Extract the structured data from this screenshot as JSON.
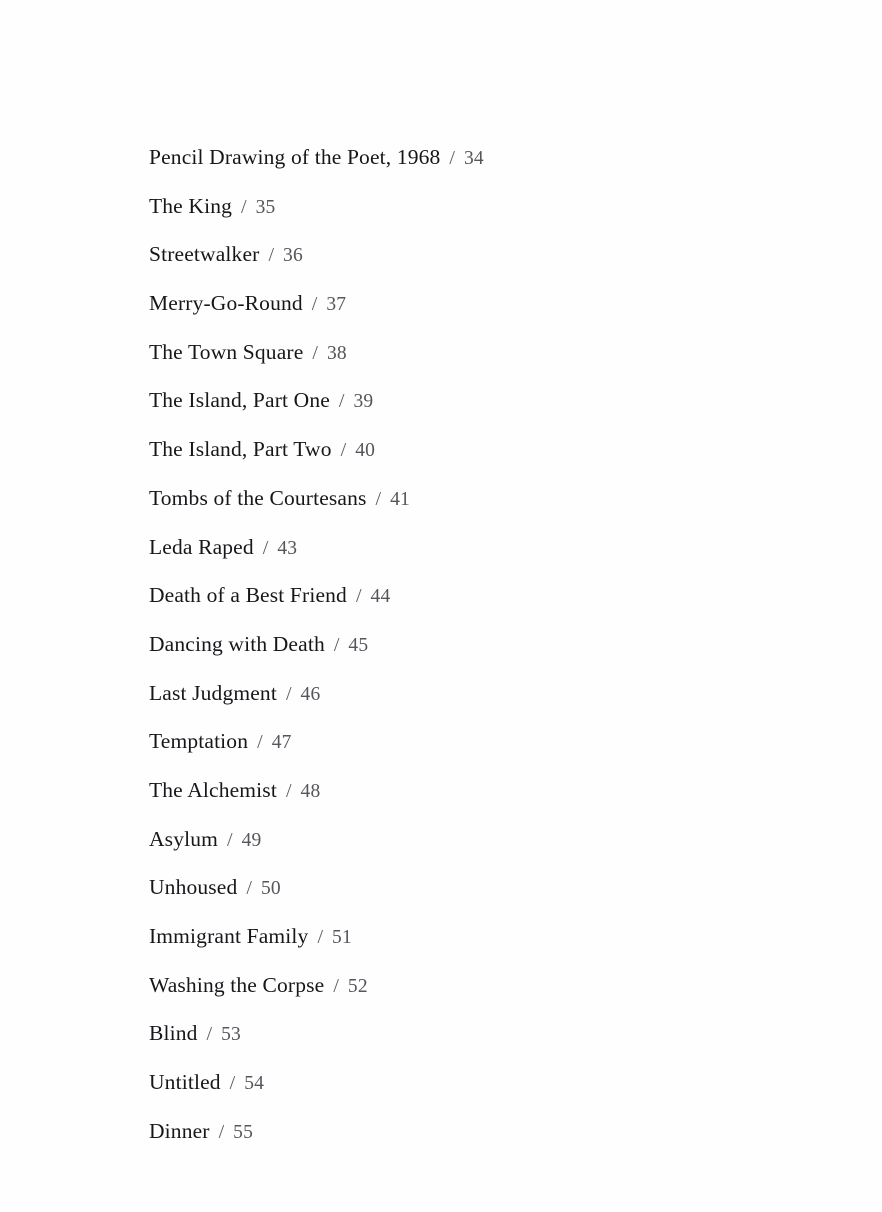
{
  "document": {
    "kind": "table-of-contents",
    "separator": "/",
    "background_color": "#fefefe",
    "title_color": "#17171b",
    "page_number_color": "#55555c"
  },
  "entries": [
    {
      "title": "Pencil Drawing of the Poet, 1968",
      "page": "34"
    },
    {
      "title": "The King",
      "page": "35"
    },
    {
      "title": "Streetwalker",
      "page": "36"
    },
    {
      "title": "Merry-Go-Round",
      "page": "37"
    },
    {
      "title": "The Town Square",
      "page": "38"
    },
    {
      "title": "The Island, Part One",
      "page": "39"
    },
    {
      "title": "The Island, Part Two",
      "page": "40"
    },
    {
      "title": "Tombs of the Courtesans",
      "page": "41"
    },
    {
      "title": "Leda Raped",
      "page": "43"
    },
    {
      "title": "Death of a Best Friend",
      "page": "44"
    },
    {
      "title": "Dancing with Death",
      "page": "45"
    },
    {
      "title": "Last Judgment",
      "page": "46"
    },
    {
      "title": "Temptation",
      "page": "47"
    },
    {
      "title": "The Alchemist",
      "page": "48"
    },
    {
      "title": "Asylum",
      "page": "49"
    },
    {
      "title": "Unhoused",
      "page": "50"
    },
    {
      "title": "Immigrant Family",
      "page": "51"
    },
    {
      "title": "Washing the Corpse",
      "page": "52"
    },
    {
      "title": "Blind",
      "page": "53"
    },
    {
      "title": "Untitled",
      "page": "54"
    },
    {
      "title": "Dinner",
      "page": "55"
    }
  ]
}
